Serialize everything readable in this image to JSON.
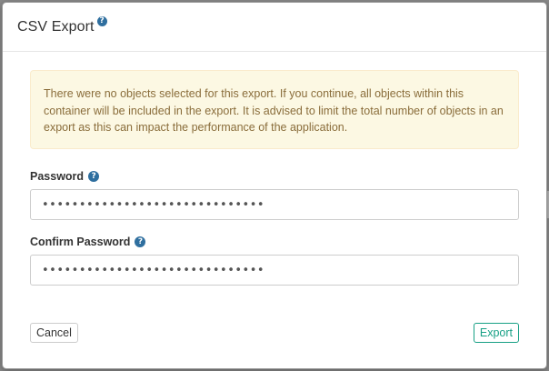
{
  "dialog": {
    "title": "CSV Export",
    "title_help_icon": "?",
    "alert_text": "There were no objects selected for this export. If you continue, all objects within this container will be included in the export. It is advised to limit the total number of objects in an export as this can impact the performance of the application.",
    "password": {
      "label": "Password",
      "help_icon": "?",
      "value": "••••••••••••••••••••••••••••••"
    },
    "confirm_password": {
      "label": "Confirm Password",
      "help_icon": "?",
      "value": "••••••••••••••••••••••••••••••"
    },
    "footer": {
      "cancel_label": "Cancel",
      "export_label": "Export"
    }
  },
  "colors": {
    "alert_background": "#fcf8e3",
    "alert_text": "#8a6d3b",
    "help_icon": "#2f6f9f",
    "export_accent": "#17a085"
  }
}
